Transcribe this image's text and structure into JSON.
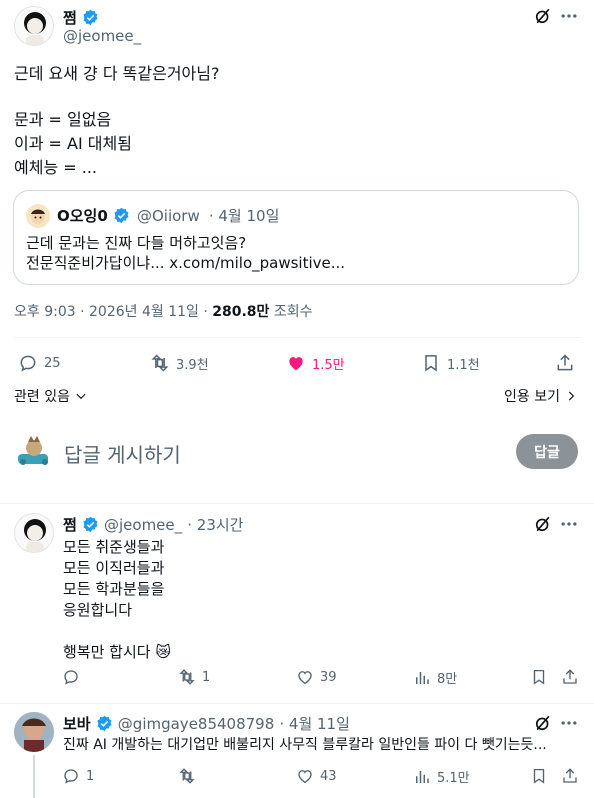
{
  "main_tweet": {
    "name": "쩜",
    "handle": "@jeomee_",
    "lines": [
      "근데 요새 걍 다 똑같은거아님?",
      "",
      "문과 =  일없음",
      "이과 = AI 대체됨",
      "예체능 = ..."
    ],
    "quote": {
      "name": "O오잉0",
      "handle": "@Oiiorw",
      "date": "· 4월 10일",
      "line1": "근데 문과는 진짜 다들 머하고잇음?",
      "line2": "전문직준비가답이냐... x.com/milo_pawsitive..."
    },
    "meta": {
      "time": "오후 9:03 · 2026년 4월 11일 ·",
      "views_count": "280.8만",
      "views_label": "조회수"
    },
    "actions": {
      "replies": "25",
      "retweets": "3.9천",
      "likes": "1.5만",
      "bookmarks": "1.1천"
    }
  },
  "related": {
    "label": "관련 있음",
    "quotes_label": "인용 보기"
  },
  "reply_box": {
    "placeholder": "답글 게시하기",
    "button": "답글"
  },
  "reply1": {
    "name": "쩜",
    "handle": "@jeomee_",
    "time": "· 23시간",
    "lines": [
      "모든 취준생들과",
      "모든 이직러들과",
      "모든 학과분들을",
      "응원합니다",
      "",
      "행복만 합시다 😿"
    ],
    "actions": {
      "replies": "",
      "retweets": "1",
      "likes": "39",
      "views": "8만"
    }
  },
  "reply2": {
    "name": "보바",
    "handle": "@gimgaye85408798",
    "time": "· 4월 11일",
    "text": "진짜 AI 개발하는 대기업만 배불리지 사무직 블루칼라 일반인들 파이 다 뺏기는듯...",
    "actions": {
      "replies": "1",
      "retweets": "",
      "likes": "43",
      "views": "5.1만"
    }
  },
  "colors": {
    "like_active": "#f91880",
    "verified": "#1d9bf0",
    "muted": "#536471",
    "button_bg": "#8b9298"
  }
}
